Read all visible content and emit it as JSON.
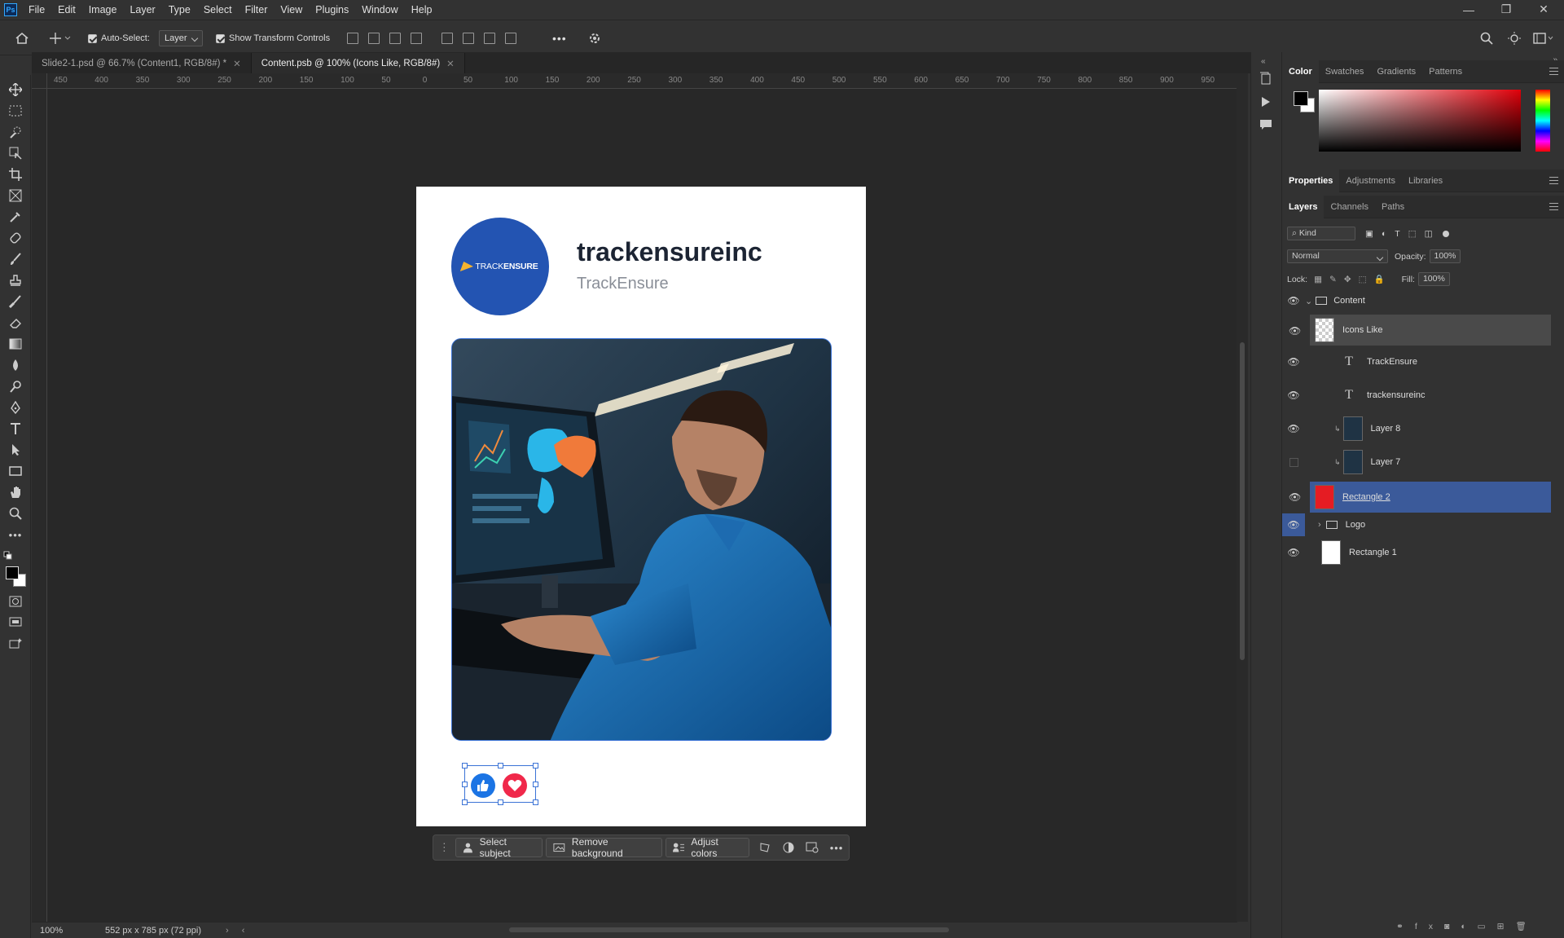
{
  "menu": {
    "app_icon": "Ps",
    "items": [
      "File",
      "Edit",
      "Image",
      "Layer",
      "Type",
      "Select",
      "Filter",
      "View",
      "Plugins",
      "Window",
      "Help"
    ],
    "window_controls": [
      "minimize-icon",
      "restore-icon",
      "close-icon"
    ]
  },
  "options": {
    "auto_select_label": "Auto-Select:",
    "auto_select_value": "Layer",
    "show_transform_label": "Show Transform Controls",
    "more": "•••"
  },
  "tabs": [
    {
      "label": "Slide2-1.psd @ 66.7% (Content1, RGB/8#) *",
      "active": false
    },
    {
      "label": "Content.psb @ 100% (Icons Like, RGB/8#)",
      "active": true
    }
  ],
  "ruler": {
    "h_ticks": [
      "450",
      "400",
      "350",
      "300",
      "250",
      "200",
      "150",
      "100",
      "50",
      "0",
      "50",
      "100",
      "150",
      "200",
      "250",
      "300",
      "350",
      "400",
      "450",
      "500",
      "550",
      "600",
      "650",
      "700",
      "750",
      "800",
      "850",
      "900",
      "950"
    ]
  },
  "artboard": {
    "avatar_logo_a": "TRACK",
    "avatar_logo_b": "ENSURE",
    "name": "trackensureinc",
    "handle": "TrackEnsure"
  },
  "context_bar": {
    "select_subject": "Select subject",
    "remove_background": "Remove background",
    "adjust_colors": "Adjust colors",
    "more": "•••"
  },
  "status": {
    "zoom": "100%",
    "doc_size": "552 px x 785 px (72 ppi)"
  },
  "color_panel": {
    "tabs": [
      "Color",
      "Swatches",
      "Gradients",
      "Patterns"
    ],
    "foreground": "#000000",
    "background": "#ffffff"
  },
  "properties_panel": {
    "tabs": [
      "Properties",
      "Adjustments",
      "Libraries"
    ]
  },
  "layers_panel": {
    "tabs": [
      "Layers",
      "Channels",
      "Paths"
    ],
    "filter_kind": "Kind",
    "blend_mode": "Normal",
    "opacity_label": "Opacity:",
    "opacity_value": "100%",
    "lock_label": "Lock:",
    "fill_label": "Fill:",
    "fill_value": "100%",
    "layers": [
      {
        "name": "Content",
        "type": "group",
        "visible": true
      },
      {
        "name": "Icons Like",
        "type": "smart",
        "visible": true,
        "active": true
      },
      {
        "name": "TrackEnsure",
        "type": "text",
        "visible": true
      },
      {
        "name": "trackensureinc",
        "type": "text",
        "visible": true
      },
      {
        "name": "Layer 8",
        "type": "image",
        "visible": true
      },
      {
        "name": "Layer 7",
        "type": "image",
        "visible": false
      },
      {
        "name": "Rectangle 2",
        "type": "shape",
        "visible": true,
        "selected": true
      },
      {
        "name": "Logo",
        "type": "group",
        "visible": true
      },
      {
        "name": "Rectangle 1",
        "type": "shape",
        "visible": true
      }
    ]
  },
  "colors": {
    "accent": "#31a8ff",
    "selection": "#3b5a9a",
    "like_blue": "#1b74e4",
    "love_red": "#f0284a",
    "avatar_blue": "#2354b2"
  }
}
